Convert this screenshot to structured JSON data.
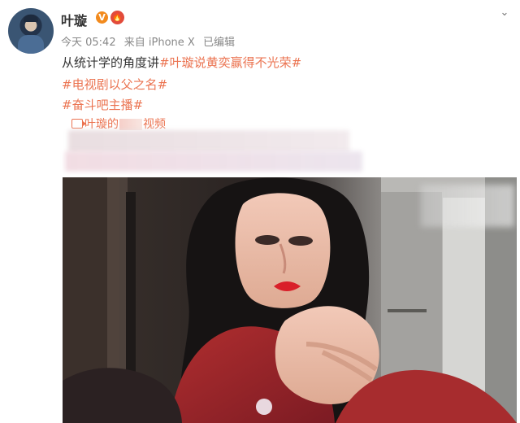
{
  "profile": {
    "name": "叶璇",
    "avatar": "avatar"
  },
  "badges": {
    "verified_icon": "V",
    "fire_icon": "🔥"
  },
  "meta": {
    "time": "今天 05:42",
    "device": "来自 iPhone X",
    "edited": "已编辑"
  },
  "post": {
    "line1_prefix": "从统计学的角度讲",
    "line1_tag": "#叶璇说黄奕赢得不光荣#",
    "line2_tag": "#电视剧以父之名#",
    "line3_tag": "#奋斗吧主播#",
    "video_prefix": "叶璇的",
    "video_suffix": "视频"
  },
  "colors": {
    "accent": "#eb7350",
    "text": "#333333",
    "meta": "#888888"
  },
  "media": {
    "type": "photo"
  }
}
